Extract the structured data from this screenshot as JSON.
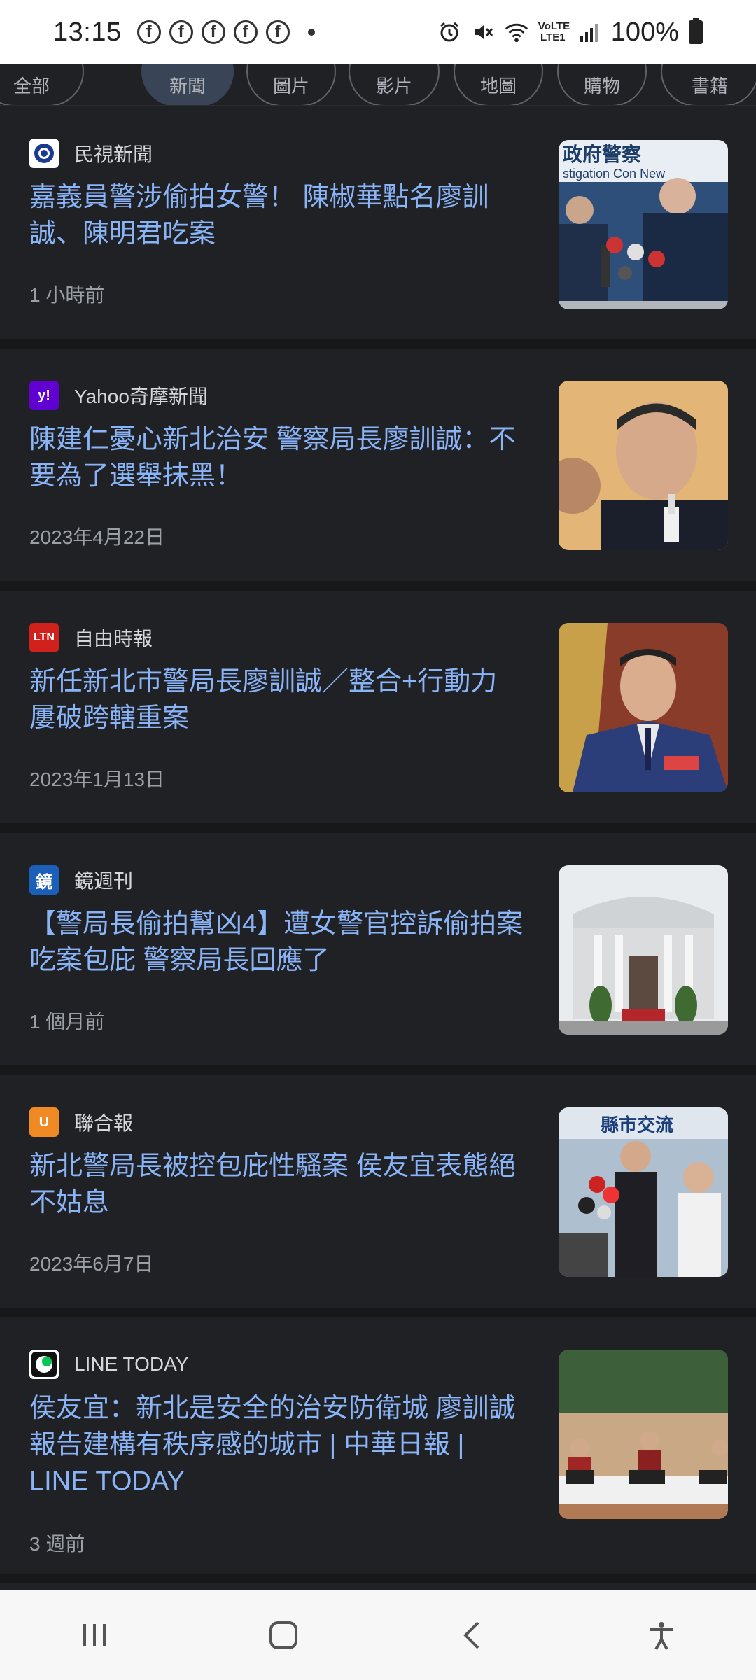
{
  "status_bar": {
    "time": "13:15",
    "notification_icons": [
      "facebook-icon",
      "facebook-icon",
      "facebook-icon",
      "facebook-icon",
      "facebook-icon"
    ],
    "battery": "100%",
    "network": "VoLTE LTE1"
  },
  "chips": [
    {
      "label": "全部"
    },
    {
      "label": "新聞"
    },
    {
      "label": "圖片"
    },
    {
      "label": "影片"
    },
    {
      "label": "地圖"
    },
    {
      "label": "購物"
    },
    {
      "label": "書籍"
    }
  ],
  "articles": [
    {
      "source": "民視新聞",
      "logo_text": "◉",
      "logo_color": "#ffffff",
      "headline": "嘉義員警涉偷拍女警！ 陳椒華點名廖訓誠、陳明君吃案",
      "time": "1 小時前",
      "thumb_icon": "press-conference-image"
    },
    {
      "source": "Yahoo奇摩新聞",
      "logo_text": "y!",
      "logo_color": "#6001d2",
      "headline": "陳建仁憂心新北治安 警察局長廖訓誠：不要為了選舉抹黑！",
      "time": "2023年4月22日",
      "thumb_icon": "police-chief-portrait-image"
    },
    {
      "source": "自由時報",
      "logo_text": "LTN",
      "logo_color": "#d0211c",
      "headline": "新任新北市警局長廖訓誠／整合+行動力 屢破跨轄重案",
      "time": "2023年1月13日",
      "thumb_icon": "uniformed-officer-image"
    },
    {
      "source": "鏡週刊",
      "logo_text": "鏡",
      "logo_color": "#1c5fb8",
      "headline": "【警局長偷拍幫凶4】遭女警官控訴偷拍案吃案包庇 警察局長回應了",
      "time": "1 個月前",
      "thumb_icon": "government-building-image"
    },
    {
      "source": "聯合報",
      "logo_text": "U",
      "logo_color": "#f08a24",
      "headline": "新北警局長被控包庇性騷案 侯友宜表態絕不姑息",
      "time": "2023年6月7日",
      "thumb_icon": "media-interview-image"
    },
    {
      "source": "LINE TODAY",
      "logo_text": "●",
      "logo_color": "#ffffff",
      "headline": "侯友宜：新北是安全的治安防衛城 廖訓誠報告建構有秩序感的城市 | 中華日報 | LINE TODAY",
      "time": "3 週前",
      "thumb_icon": "meeting-room-image"
    }
  ],
  "nav_bar": {
    "recents": "recents-icon",
    "home": "home-icon",
    "back": "back-icon",
    "accessibility": "accessibility-icon"
  }
}
